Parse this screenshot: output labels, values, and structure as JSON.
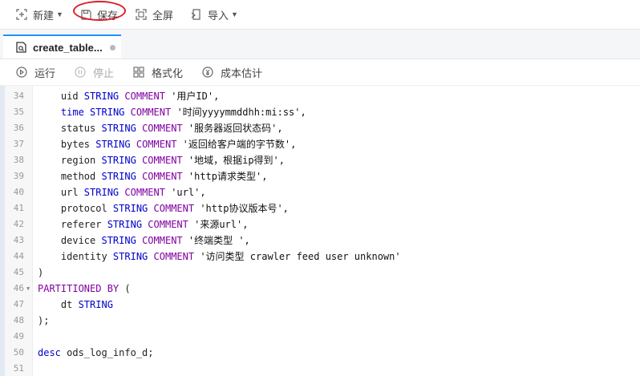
{
  "toolbar": {
    "new_label": "新建",
    "save_label": "保存",
    "fullscreen_label": "全屏",
    "import_label": "导入",
    "highlight_color": "#d9202a"
  },
  "tabs": [
    {
      "label": "create_table..."
    }
  ],
  "actions": {
    "run_label": "运行",
    "stop_label": "停止",
    "format_label": "格式化",
    "cost_label": "成本估计"
  },
  "editor": {
    "lines": [
      {
        "no": "34",
        "fold": false,
        "tokens": [
          {
            "t": "    uid ",
            "c": "p"
          },
          {
            "t": "STRING",
            "c": "k"
          },
          {
            "t": " ",
            "c": "p"
          },
          {
            "t": "COMMENT",
            "c": "x"
          },
          {
            "t": " '用户ID',",
            "c": "s"
          }
        ]
      },
      {
        "no": "35",
        "fold": false,
        "tokens": [
          {
            "t": "    ",
            "c": "p"
          },
          {
            "t": "time",
            "c": "k"
          },
          {
            "t": " ",
            "c": "p"
          },
          {
            "t": "STRING",
            "c": "k"
          },
          {
            "t": " ",
            "c": "p"
          },
          {
            "t": "COMMENT",
            "c": "x"
          },
          {
            "t": " '时间yyyymmddhh:mi:ss',",
            "c": "s"
          }
        ]
      },
      {
        "no": "36",
        "fold": false,
        "tokens": [
          {
            "t": "    status ",
            "c": "p"
          },
          {
            "t": "STRING",
            "c": "k"
          },
          {
            "t": " ",
            "c": "p"
          },
          {
            "t": "COMMENT",
            "c": "x"
          },
          {
            "t": " '服务器返回状态码',",
            "c": "s"
          }
        ]
      },
      {
        "no": "37",
        "fold": false,
        "tokens": [
          {
            "t": "    bytes ",
            "c": "p"
          },
          {
            "t": "STRING",
            "c": "k"
          },
          {
            "t": " ",
            "c": "p"
          },
          {
            "t": "COMMENT",
            "c": "x"
          },
          {
            "t": " '返回给客户端的字节数',",
            "c": "s"
          }
        ]
      },
      {
        "no": "38",
        "fold": false,
        "tokens": [
          {
            "t": "    region ",
            "c": "p"
          },
          {
            "t": "STRING",
            "c": "k"
          },
          {
            "t": " ",
            "c": "p"
          },
          {
            "t": "COMMENT",
            "c": "x"
          },
          {
            "t": " '地域，根据ip得到',",
            "c": "s"
          }
        ]
      },
      {
        "no": "39",
        "fold": false,
        "tokens": [
          {
            "t": "    method ",
            "c": "p"
          },
          {
            "t": "STRING",
            "c": "k"
          },
          {
            "t": " ",
            "c": "p"
          },
          {
            "t": "COMMENT",
            "c": "x"
          },
          {
            "t": " 'http请求类型',",
            "c": "s"
          }
        ]
      },
      {
        "no": "40",
        "fold": false,
        "tokens": [
          {
            "t": "    url ",
            "c": "p"
          },
          {
            "t": "STRING",
            "c": "k"
          },
          {
            "t": " ",
            "c": "p"
          },
          {
            "t": "COMMENT",
            "c": "x"
          },
          {
            "t": " 'url',",
            "c": "s"
          }
        ]
      },
      {
        "no": "41",
        "fold": false,
        "tokens": [
          {
            "t": "    protocol ",
            "c": "p"
          },
          {
            "t": "STRING",
            "c": "k"
          },
          {
            "t": " ",
            "c": "p"
          },
          {
            "t": "COMMENT",
            "c": "x"
          },
          {
            "t": " 'http协议版本号',",
            "c": "s"
          }
        ]
      },
      {
        "no": "42",
        "fold": false,
        "tokens": [
          {
            "t": "    referer ",
            "c": "p"
          },
          {
            "t": "STRING",
            "c": "k"
          },
          {
            "t": " ",
            "c": "p"
          },
          {
            "t": "COMMENT",
            "c": "x"
          },
          {
            "t": " '来源url',",
            "c": "s"
          }
        ]
      },
      {
        "no": "43",
        "fold": false,
        "tokens": [
          {
            "t": "    device ",
            "c": "p"
          },
          {
            "t": "STRING",
            "c": "k"
          },
          {
            "t": " ",
            "c": "p"
          },
          {
            "t": "COMMENT",
            "c": "x"
          },
          {
            "t": " '终端类型 ',",
            "c": "s"
          }
        ]
      },
      {
        "no": "44",
        "fold": false,
        "tokens": [
          {
            "t": "    identity ",
            "c": "p"
          },
          {
            "t": "STRING",
            "c": "k"
          },
          {
            "t": " ",
            "c": "p"
          },
          {
            "t": "COMMENT",
            "c": "x"
          },
          {
            "t": " '访问类型 crawler feed user unknown'",
            "c": "s"
          }
        ]
      },
      {
        "no": "45",
        "fold": false,
        "tokens": [
          {
            "t": ")",
            "c": "p"
          }
        ]
      },
      {
        "no": "46",
        "fold": true,
        "tokens": [
          {
            "t": "PARTITIONED BY",
            "c": "x"
          },
          {
            "t": " (",
            "c": "p"
          }
        ]
      },
      {
        "no": "47",
        "fold": false,
        "tokens": [
          {
            "t": "    dt ",
            "c": "p"
          },
          {
            "t": "STRING",
            "c": "k"
          }
        ]
      },
      {
        "no": "48",
        "fold": false,
        "tokens": [
          {
            "t": ");",
            "c": "p"
          }
        ]
      },
      {
        "no": "49",
        "fold": false,
        "tokens": []
      },
      {
        "no": "50",
        "fold": false,
        "tokens": [
          {
            "t": "desc",
            "c": "k"
          },
          {
            "t": " ods_log_info_d;",
            "c": "p"
          }
        ]
      },
      {
        "no": "51",
        "fold": false,
        "tokens": []
      }
    ]
  }
}
